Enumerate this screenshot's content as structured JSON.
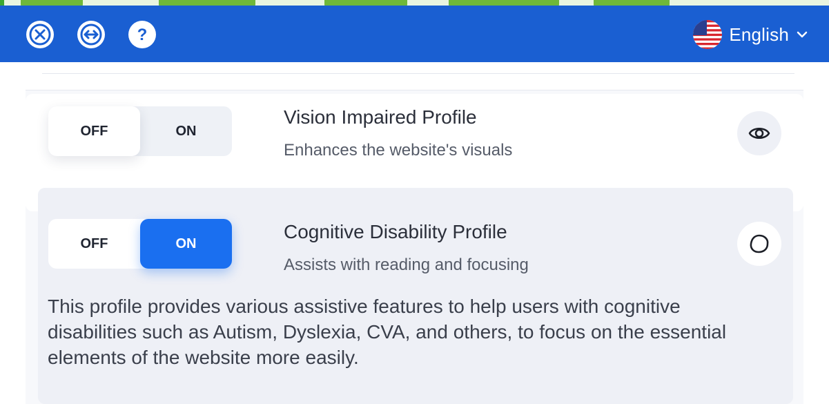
{
  "header": {
    "language_label": "English",
    "buttons": [
      "close-icon",
      "resize-icon",
      "help-icon"
    ]
  },
  "profiles": [
    {
      "title": "Vision Impaired Profile",
      "subtitle": "Enhances the website's visuals",
      "toggle": {
        "off_label": "OFF",
        "on_label": "ON",
        "state": "off"
      },
      "icon": "eye-icon"
    },
    {
      "title": "Cognitive Disability Profile",
      "subtitle": "Assists with reading and focusing",
      "toggle": {
        "off_label": "OFF",
        "on_label": "ON",
        "state": "on"
      },
      "icon": "circle-outline-icon",
      "description": "This profile provides various assistive features to help users with cognitive disabilities such as Autism, Dyslexia, CVA, and others, to focus on the essential elements of the website more easily."
    }
  ],
  "colors": {
    "header_bg": "#1a5fd2",
    "accent_on": "#1a6ff0",
    "card_selected_bg": "#eef0f6"
  }
}
